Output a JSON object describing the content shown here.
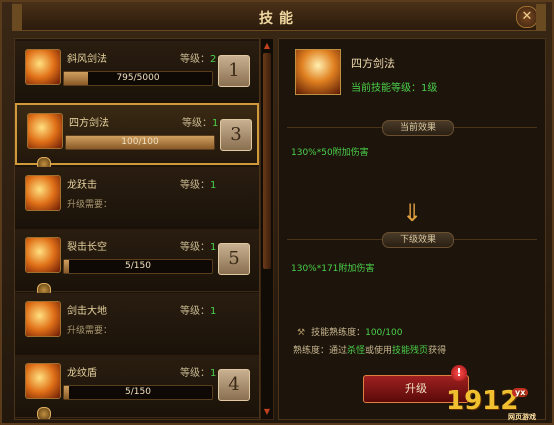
{
  "window": {
    "title": "技能",
    "close_label": "✕"
  },
  "skills": [
    {
      "name": "斜风剑法",
      "level_label": "等级：",
      "level": "2",
      "exp": "795/5000",
      "exp_progress": 0.159,
      "key": "1",
      "need_label": null
    },
    {
      "name": "四方剑法",
      "level_label": "等级：",
      "level": "1",
      "exp": "100/100",
      "exp_progress": 1.0,
      "key": "3",
      "need_label": null
    },
    {
      "name": "龙跃击",
      "level_label": "等级：",
      "level": "1",
      "exp": null,
      "key": null,
      "need_label": "升级需要："
    },
    {
      "name": "裂击长空",
      "level_label": "等级：",
      "level": "1",
      "exp": "5/150",
      "exp_progress": 0.033,
      "key": "5",
      "need_label": null
    },
    {
      "name": "剑击大地",
      "level_label": "等级：",
      "level": "1",
      "exp": null,
      "key": null,
      "need_label": "升级需要："
    },
    {
      "name": "龙纹盾",
      "level_label": "等级：",
      "level": "1",
      "exp": "5/150",
      "exp_progress": 0.033,
      "key": "4",
      "need_label": null
    }
  ],
  "detail": {
    "name": "四方剑法",
    "current_level": "当前技能等级：1级",
    "current_effect_title": "当前效果",
    "current_effect": "130%*50附加伤害",
    "next_effect_title": "下级效果",
    "next_effect": "130%*171附加伤害",
    "proficiency_label": "技能熟练度：",
    "proficiency_value": "100/100",
    "tip_prefix": "熟练度：通过",
    "tip_kill": "杀怪",
    "tip_or": "或使用",
    "tip_book": "技能残页",
    "tip_suffix": "获得",
    "upgrade_label": "升级",
    "alert": "!"
  },
  "logo": {
    "text": "1912",
    "yx": "yx",
    "sub": "网页游戏"
  },
  "colors": {
    "accent_green": "#4ad04a",
    "upgrade_red": "#a02020",
    "frame_gold": "#d09a3a"
  }
}
